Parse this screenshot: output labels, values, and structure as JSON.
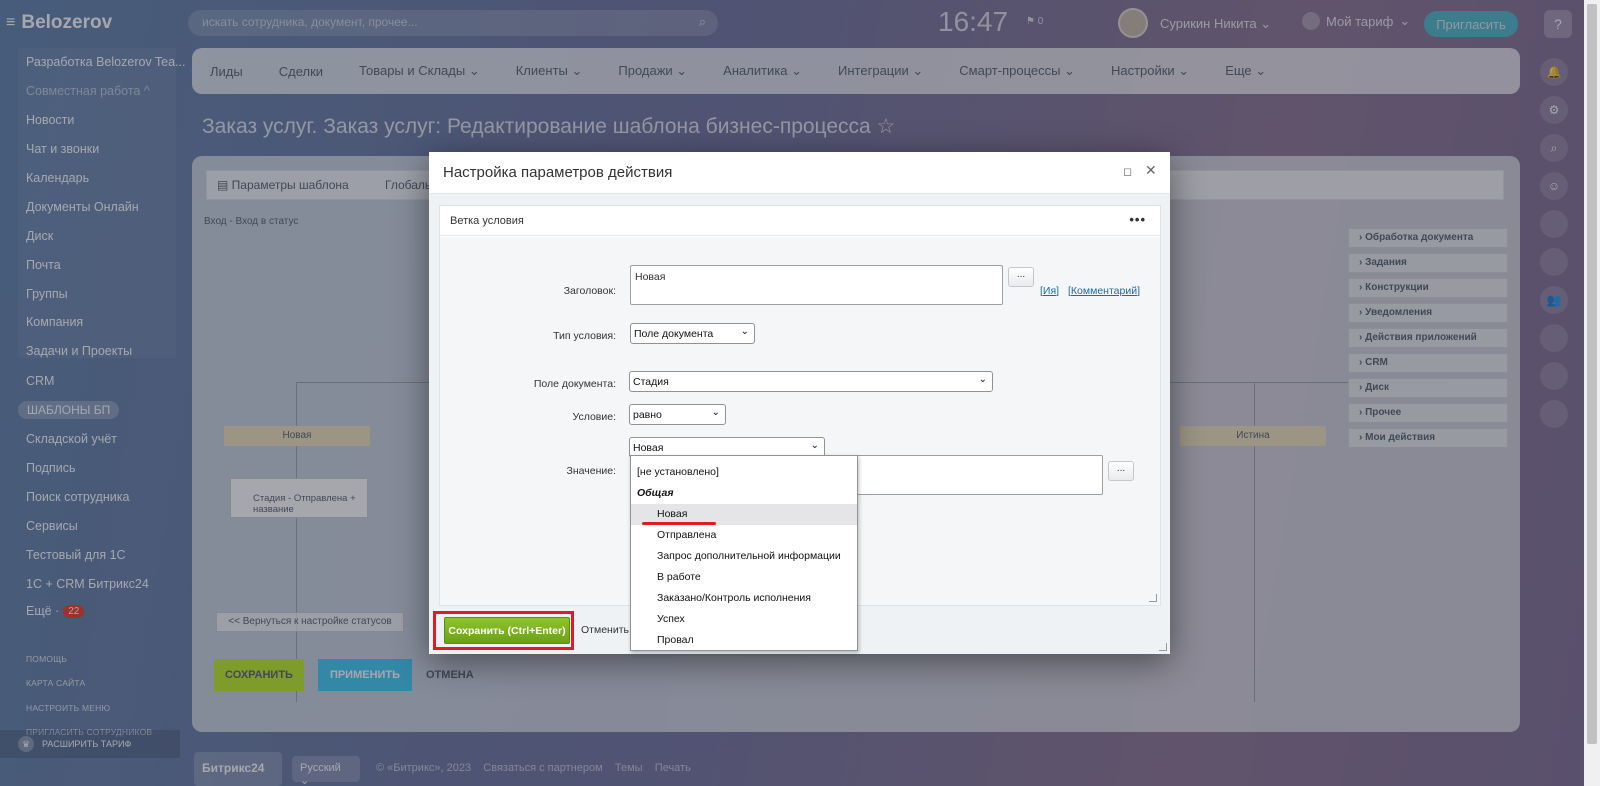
{
  "app": {
    "brand": "Belozerov"
  },
  "header": {
    "search_placeholder": "искать сотрудника, документ, прочее...",
    "clock": "16:47",
    "clock_flag": "0",
    "user_name": "Сурикин Никита",
    "tariff_label": "Мой тариф",
    "invite_label": "Пригласить",
    "help_label": "?"
  },
  "sidebar": {
    "items": [
      {
        "label": "Разработка Belozerov Tea..."
      },
      {
        "label": "Совместная работа ^"
      },
      {
        "label": "Новости"
      },
      {
        "label": "Чат и звонки"
      },
      {
        "label": "Календарь"
      },
      {
        "label": "Документы Онлайн"
      },
      {
        "label": "Диск"
      },
      {
        "label": "Почта"
      },
      {
        "label": "Группы"
      },
      {
        "label": "Компания"
      },
      {
        "label": "Задачи и Проекты"
      },
      {
        "label": "CRM"
      },
      {
        "label": "Складской учёт"
      },
      {
        "label": "Подпись"
      },
      {
        "label": "Поиск сотрудника"
      },
      {
        "label": "Сервисы"
      },
      {
        "label": "Тестовый для 1С"
      },
      {
        "label": "1С + CRM Битрикс24"
      },
      {
        "label": "Ещё ·"
      }
    ],
    "active_pill": "ШАБЛОНЫ БП",
    "more_badge": "22",
    "small_links": [
      "ПОМОЩЬ",
      "КАРТА САЙТА",
      "НАСТРОИТЬ МЕНЮ",
      "ПРИГЛАСИТЬ СОТРУДНИКОВ"
    ],
    "expand_label": "РАСШИРИТЬ ТАРИФ"
  },
  "topmenu": {
    "items": [
      "Лиды",
      "Сделки",
      "Товары и Склады ⌄",
      "Клиенты ⌄",
      "Продажи ⌄",
      "Аналитика ⌄",
      "Интеграции ⌄",
      "Смарт-процессы ⌄",
      "Настройки ⌄",
      "Еще ⌄"
    ]
  },
  "page": {
    "title": "Заказ услуг. Заказ услуг: Редактирование шаблона бизнес-процесса ☆",
    "tabs": [
      "Параметры шаблона",
      "Глобальн"
    ],
    "breadcrumb": "Вход - Вход в статус",
    "right_panel": [
      "Обработка документа",
      "Задания",
      "Конструкции",
      "Уведомления",
      "Действия приложений",
      "CRM",
      "Диск",
      "Прочее",
      "Мои действия"
    ],
    "node_left": "Новая",
    "node_right": "Истина",
    "node_activity": "Стадия - Отправлена + название",
    "back_button": "<< Вернуться к настройке статусов",
    "save": "СОХРАНИТЬ",
    "apply": "ПРИМЕНИТЬ",
    "cancel": "ОТМЕНА"
  },
  "footer": {
    "brand": "Битрикс24",
    "lang": "Русский ⌄",
    "text": "© «Битрикс», 2023    Связаться с партнером    Темы    Печать"
  },
  "dialog": {
    "title": "Настройка параметров действия",
    "section": "Ветка условия",
    "labels": {
      "heading": "Заголовок:",
      "condition_type": "Тип условия:",
      "doc_field": "Поле документа:",
      "condition": "Условие:",
      "value": "Значение:"
    },
    "heading_value": "Новая",
    "condition_type_value": "Поле документа",
    "doc_field_value": "Стадия",
    "condition_value": "равно",
    "value_select": "Новая",
    "dots_button": "...",
    "link_name": "Ия",
    "link_comment": "Комментарий",
    "save_button": "Сохранить (Ctrl+Enter)",
    "cancel_button": "Отменить",
    "options": [
      {
        "label": "[не установлено]",
        "type": "option"
      },
      {
        "label": "Общая",
        "type": "group"
      },
      {
        "label": "Новая",
        "type": "option",
        "selected": true
      },
      {
        "label": "Отправлена",
        "type": "option"
      },
      {
        "label": "Запрос дополнительной информации",
        "type": "option"
      },
      {
        "label": "В работе",
        "type": "option"
      },
      {
        "label": "Заказано/Контроль исполнения",
        "type": "option"
      },
      {
        "label": "Успех",
        "type": "option"
      },
      {
        "label": "Провал",
        "type": "option"
      }
    ]
  },
  "colors": {
    "accent_green": "#7db31e",
    "highlight_red": "#e01b24",
    "invite": "#3bc8d8"
  }
}
